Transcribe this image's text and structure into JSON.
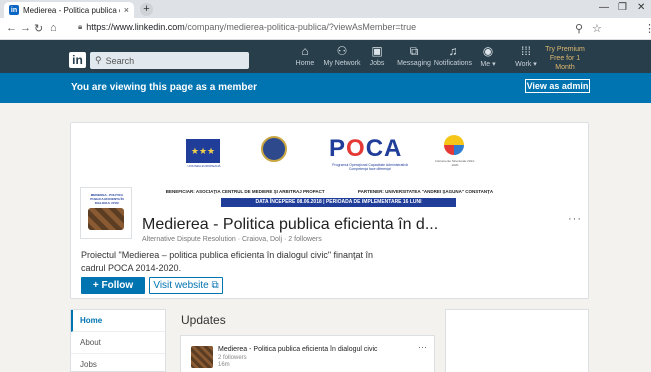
{
  "browser": {
    "tab_title": "Medierea - Politica publica eficie",
    "tab_close": "×",
    "new_tab": "+",
    "url_host": "https://www.linkedin.com",
    "url_path": "/company/medierea-politica-publica/?viewAsMember=true",
    "win_min": "—",
    "win_max": "❐",
    "win_close": "✕"
  },
  "linkedin_nav": {
    "search_placeholder": "Search",
    "items": [
      {
        "label": "Home",
        "icon": "home-icon"
      },
      {
        "label": "My Network",
        "icon": "network-icon"
      },
      {
        "label": "Jobs",
        "icon": "jobs-icon"
      },
      {
        "label": "Messaging",
        "icon": "messaging-icon"
      },
      {
        "label": "Notifications",
        "icon": "bell-icon"
      },
      {
        "label": "Me ▾",
        "icon": "avatar-icon"
      },
      {
        "label": "Work ▾",
        "icon": "grid-icon"
      }
    ],
    "premium_line1": "Try Premium",
    "premium_line2": "Free for 1",
    "premium_line3": "Month"
  },
  "member_bar": {
    "text": "You are viewing this page as a member",
    "admin_button": "View as admin"
  },
  "banner": {
    "eu_caption": "UNIUNEA EUROPEANĂ",
    "poca_sub": "Programul Operaţional Capacitate Administrativă Competenţa face diferenţa!",
    "inst_caption": "Instrumente Structurale 2014-2020",
    "beneficiar": "BENEFICIAR: ASOCIAŢIA CENTRUL DE MEDIERE ŞI ARBITRAJ PROPACT",
    "partener": "PARTENER: UNIVERSITATEA \"ANDREI ŞAGUNA\" CONSTANŢA",
    "dates": "DATA ÎNCEPERE 08.06.2018 | PERIOADA DE IMPLEMENTARE 16 LUNI"
  },
  "company": {
    "logo_text": "MEDIEREA - POLITICA PUBLICA EFICIENTA ÎN DIALOGUL CIVIC",
    "name": "Medierea - Politica publica eficienta în d...",
    "meta": "Alternative Dispute Resolution · Craiova, Dolj · 2 followers",
    "description": "Proiectul \"Medierea – politica publica eficienta în dialogul civic\" finanţat în cadrul POCA 2014-2020.",
    "follow_button": "+ Follow",
    "visit_button": "Visit website ⧉",
    "more": "···"
  },
  "sidebar": {
    "items": [
      {
        "label": "Home",
        "active": true
      },
      {
        "label": "About",
        "active": false
      },
      {
        "label": "Jobs",
        "active": false
      }
    ]
  },
  "updates": {
    "title": "Updates",
    "post_author": "Medierea - Politica publica eficienta în dialogul civic",
    "post_followers": "2 followers",
    "post_time": "16m",
    "more": "···"
  }
}
